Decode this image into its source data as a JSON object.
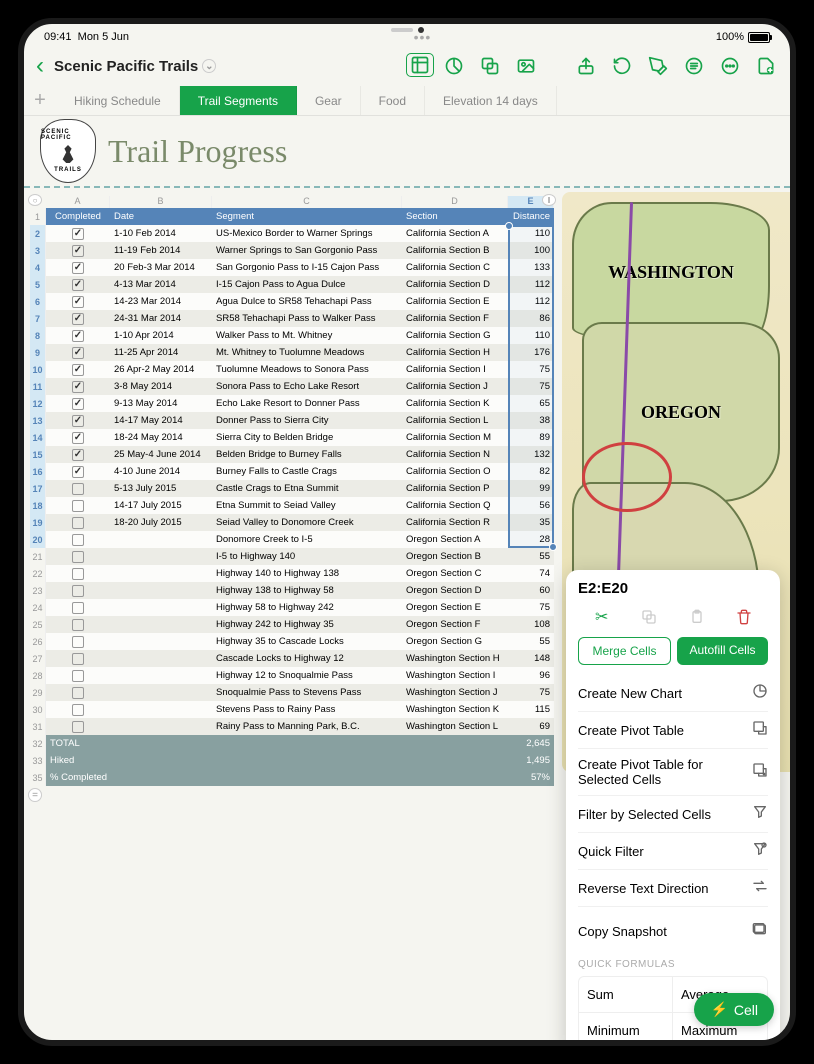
{
  "status": {
    "time": "09:41",
    "date": "Mon 5 Jun",
    "battery": "100%"
  },
  "document": {
    "title": "Scenic Pacific Trails"
  },
  "tabs": [
    {
      "label": "Hiking Schedule",
      "active": false
    },
    {
      "label": "Trail Segments",
      "active": true
    },
    {
      "label": "Gear",
      "active": false
    },
    {
      "label": "Food",
      "active": false
    },
    {
      "label": "Elevation 14 days",
      "active": false
    }
  ],
  "logo": {
    "top": "SCENIC PACIFIC",
    "bottom": "TRAILS"
  },
  "page_title": "Trail Progress",
  "columns": [
    "A",
    "B",
    "C",
    "D",
    "E"
  ],
  "table_headers": {
    "A": "Completed",
    "B": "Date",
    "C": "Segment",
    "D": "Section",
    "E": "Distance"
  },
  "rows": [
    {
      "n": 2,
      "A": true,
      "B": "1-10 Feb 2014",
      "C": "US-Mexico Border to Warner Springs",
      "D": "California Section A",
      "E": "110"
    },
    {
      "n": 3,
      "A": true,
      "B": "11-19 Feb 2014",
      "C": "Warner Springs to San Gorgonio Pass",
      "D": "California Section B",
      "E": "100"
    },
    {
      "n": 4,
      "A": true,
      "B": "20 Feb-3 Mar 2014",
      "C": "San Gorgonio Pass to I-15 Cajon Pass",
      "D": "California Section C",
      "E": "133"
    },
    {
      "n": 5,
      "A": true,
      "B": "4-13 Mar 2014",
      "C": "I-15 Cajon Pass to Agua Dulce",
      "D": "California Section D",
      "E": "112"
    },
    {
      "n": 6,
      "A": true,
      "B": "14-23 Mar 2014",
      "C": "Agua Dulce to SR58 Tehachapi Pass",
      "D": "California Section E",
      "E": "112"
    },
    {
      "n": 7,
      "A": true,
      "B": "24-31 Mar 2014",
      "C": "SR58 Tehachapi Pass to Walker Pass",
      "D": "California Section F",
      "E": "86"
    },
    {
      "n": 8,
      "A": true,
      "B": "1-10 Apr 2014",
      "C": "Walker Pass to Mt. Whitney",
      "D": "California Section G",
      "E": "110"
    },
    {
      "n": 9,
      "A": true,
      "B": "11-25 Apr 2014",
      "C": "Mt. Whitney to Tuolumne Meadows",
      "D": "California Section H",
      "E": "176"
    },
    {
      "n": 10,
      "A": true,
      "B": "26 Apr-2 May 2014",
      "C": "Tuolumne Meadows to Sonora Pass",
      "D": "California Section I",
      "E": "75"
    },
    {
      "n": 11,
      "A": true,
      "B": "3-8 May 2014",
      "C": "Sonora Pass to Echo Lake Resort",
      "D": "California Section J",
      "E": "75"
    },
    {
      "n": 12,
      "A": true,
      "B": "9-13 May 2014",
      "C": "Echo Lake Resort to Donner Pass",
      "D": "California Section K",
      "E": "65"
    },
    {
      "n": 13,
      "A": true,
      "B": "14-17 May 2014",
      "C": "Donner Pass to Sierra City",
      "D": "California Section L",
      "E": "38"
    },
    {
      "n": 14,
      "A": true,
      "B": "18-24 May 2014",
      "C": "Sierra City to Belden Bridge",
      "D": "California Section M",
      "E": "89"
    },
    {
      "n": 15,
      "A": true,
      "B": "25 May-4 June 2014",
      "C": "Belden Bridge to Burney Falls",
      "D": "California Section N",
      "E": "132"
    },
    {
      "n": 16,
      "A": true,
      "B": "4-10 June 2014",
      "C": "Burney Falls to Castle Crags",
      "D": "California Section O",
      "E": "82"
    },
    {
      "n": 17,
      "A": false,
      "B": "5-13 July 2015",
      "C": "Castle Crags to Etna Summit",
      "D": "California Section P",
      "E": "99"
    },
    {
      "n": 18,
      "A": false,
      "B": "14-17 July 2015",
      "C": "Etna Summit to Seiad Valley",
      "D": "California Section Q",
      "E": "56"
    },
    {
      "n": 19,
      "A": false,
      "B": "18-20 July 2015",
      "C": "Seiad Valley to Donomore Creek",
      "D": "California Section R",
      "E": "35"
    },
    {
      "n": 20,
      "A": false,
      "B": "",
      "C": "Donomore Creek to I-5",
      "D": "Oregon Section A",
      "E": "28"
    },
    {
      "n": 21,
      "A": false,
      "B": "",
      "C": "I-5 to Highway 140",
      "D": "Oregon Section B",
      "E": "55"
    },
    {
      "n": 22,
      "A": false,
      "B": "",
      "C": "Highway 140 to Highway 138",
      "D": "Oregon Section C",
      "E": "74"
    },
    {
      "n": 23,
      "A": false,
      "B": "",
      "C": "Highway 138 to Highway 58",
      "D": "Oregon Section D",
      "E": "60"
    },
    {
      "n": 24,
      "A": false,
      "B": "",
      "C": "Highway 58 to Highway 242",
      "D": "Oregon Section E",
      "E": "75"
    },
    {
      "n": 25,
      "A": false,
      "B": "",
      "C": "Highway 242 to Highway 35",
      "D": "Oregon Section F",
      "E": "108"
    },
    {
      "n": 26,
      "A": false,
      "B": "",
      "C": "Highway 35 to Cascade Locks",
      "D": "Oregon Section G",
      "E": "55"
    },
    {
      "n": 27,
      "A": false,
      "B": "",
      "C": "Cascade Locks to Highway 12",
      "D": "Washington Section H",
      "E": "148"
    },
    {
      "n": 28,
      "A": false,
      "B": "",
      "C": "Highway 12 to Snoqualmie Pass",
      "D": "Washington Section I",
      "E": "96"
    },
    {
      "n": 29,
      "A": false,
      "B": "",
      "C": "Snoqualmie Pass to Stevens Pass",
      "D": "Washington Section J",
      "E": "75"
    },
    {
      "n": 30,
      "A": false,
      "B": "",
      "C": "Stevens Pass to Rainy Pass",
      "D": "Washington Section K",
      "E": "115"
    },
    {
      "n": 31,
      "A": false,
      "B": "",
      "C": "Rainy Pass to Manning Park, B.C.",
      "D": "Washington Section L",
      "E": "69"
    }
  ],
  "summary": [
    {
      "n": 32,
      "label": "TOTAL",
      "value": "2,645"
    },
    {
      "n": 33,
      "label": "Hiked",
      "value": "1,495"
    },
    {
      "n": 35,
      "label": "% Completed",
      "value": "57%"
    }
  ],
  "map": {
    "states": [
      "WASHINGTON",
      "OREGON"
    ]
  },
  "popover": {
    "selection": "E2:E20",
    "merge": "Merge Cells",
    "autofill": "Autofill Cells",
    "items": [
      {
        "label": "Create New Chart",
        "icon": "chart"
      },
      {
        "label": "Create Pivot Table",
        "icon": "pivot"
      },
      {
        "label": "Create Pivot Table for Selected Cells",
        "icon": "pivot2"
      },
      {
        "label": "Filter by Selected Cells",
        "icon": "filter"
      },
      {
        "label": "Quick Filter",
        "icon": "qfilter"
      },
      {
        "label": "Reverse Text Direction",
        "icon": "reverse"
      },
      {
        "label": "Copy Snapshot",
        "icon": "snapshot"
      }
    ],
    "section": "Quick Formulas",
    "formulas": [
      "Sum",
      "Average",
      "Minimum",
      "Maximum"
    ]
  },
  "fab": "Cell"
}
